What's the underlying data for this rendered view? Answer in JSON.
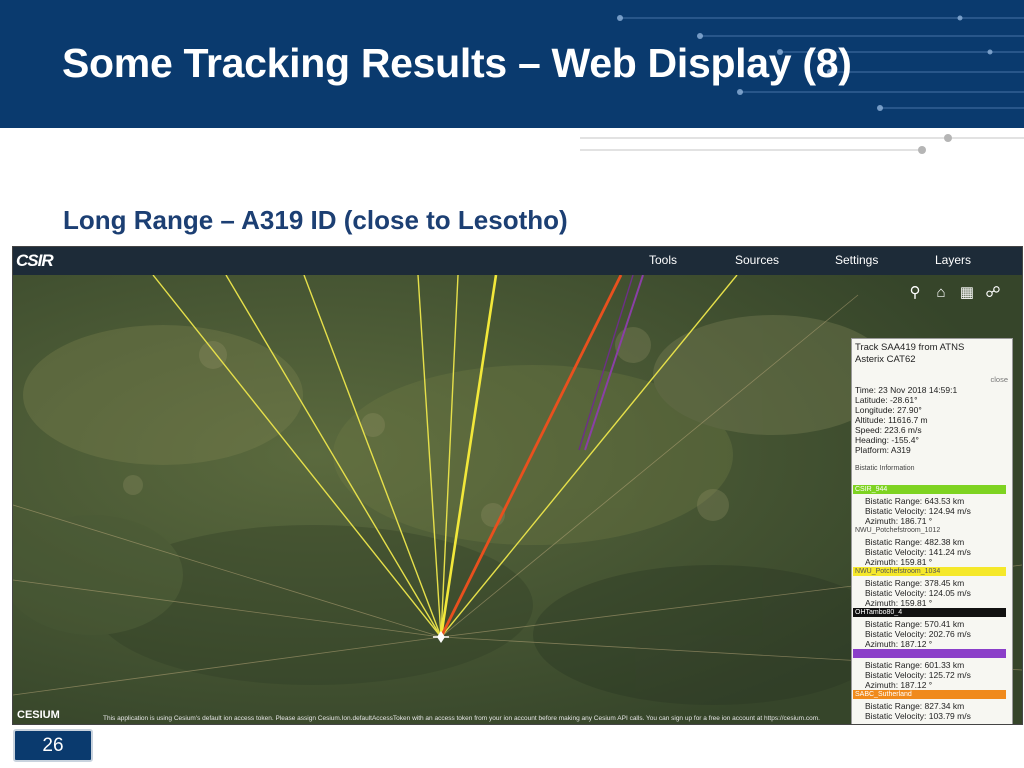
{
  "header": {
    "title": "Some Tracking Results – Web Display (8)"
  },
  "subtitle": "Long Range – A319 ID (close to Lesotho)",
  "app": {
    "logo": "CSIR",
    "menu": [
      {
        "label": "Tools"
      },
      {
        "label": "Sources"
      },
      {
        "label": "Settings"
      },
      {
        "label": "Layers"
      }
    ],
    "toolbar_icons": [
      "search-icon",
      "home-icon",
      "grid-icon",
      "globe-icon"
    ],
    "info": {
      "title1": "Track SAA419 from ATNS",
      "title2": "Asterix CAT62",
      "close": "close",
      "time": "Time: 23 Nov 2018 14:59:1",
      "latitude": "Latitude: -28.61°",
      "longitude": "Longitude: 27.90°",
      "altitude": "Altitude: 11616.7 m",
      "speed": "Speed: 223.6 m/s",
      "heading": "Heading: -155.4°",
      "platform": "Platform: A319",
      "bistatic_header": "Bistatic Information",
      "receivers": [
        {
          "name": "CSIR_944",
          "color": "#7ed321",
          "range": "Bistatic Range: 643.53 km",
          "velocity": "Bistatic Velocity: 124.94 m/s",
          "azimuth": "Azimuth: 186.71 °"
        },
        {
          "name": "NWU_Potchefstroom_1012",
          "color": "",
          "range": "Bistatic Range: 482.38 km",
          "velocity": "Bistatic Velocity: 141.24 m/s",
          "azimuth": "Azimuth: 159.81 °"
        },
        {
          "name": "NWU_Potchefstroom_1034",
          "color": "#f5e82a",
          "range": "Bistatic Range: 378.45 km",
          "velocity": "Bistatic Velocity: 124.05 m/s",
          "azimuth": "Azimuth: 159.81 °"
        },
        {
          "name": "OHTambo80_4",
          "color": "#111111",
          "range": "Bistatic Range: 570.41 km",
          "velocity": "Bistatic Velocity: 202.76 m/s",
          "azimuth": "Azimuth: 187.12 °"
        },
        {
          "name": "",
          "color": "#8b3fc9",
          "range": "Bistatic Range: 601.33 km",
          "velocity": "Bistatic Velocity: 125.72 m/s",
          "azimuth": "Azimuth: 187.12 °"
        },
        {
          "name": "SABC_Sutherland",
          "color": "#f08a1c",
          "range": "Bistatic Range: 827.34 km",
          "velocity": "Bistatic Velocity: 103.79 m/s",
          "azimuth": ""
        }
      ]
    },
    "cesium_logo": "CESIUM",
    "credit": "This application is using Cesium's default ion access token. Please assign Cesium.Ion.defaultAccessToken with an access token from your ion account before making any Cesium API calls. You can sign up for a free ion account at https://cesium.com."
  },
  "page_number": "26"
}
